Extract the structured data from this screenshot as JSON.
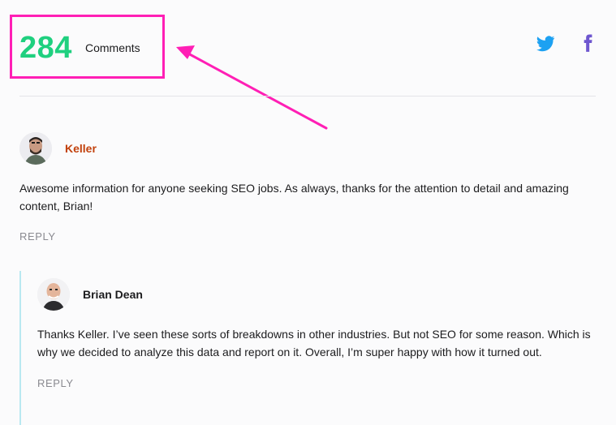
{
  "comments_header": {
    "count": "284",
    "label": "Comments"
  },
  "social": {
    "twitter": "twitter-icon",
    "facebook": "facebook-icon",
    "twitter_color": "#1da1f2",
    "facebook_color": "#6e56cf"
  },
  "annotation": {
    "highlight_color": "#ff1fb5"
  },
  "comments": [
    {
      "author": "Keller",
      "text": "Awesome information for anyone seeking SEO jobs. As always, thanks for the attention to detail and amazing content, Brian!",
      "reply_label": "REPLY"
    }
  ],
  "replies": [
    {
      "author": "Brian Dean",
      "text": "Thanks Keller. I’ve seen these sorts of breakdowns in other industries. But not SEO for some reason. Which is why we decided to analyze this data and report on it. Overall, I’m super happy with how it turned out.",
      "reply_label": "REPLY"
    }
  ],
  "colors": {
    "count_green": "#1fd07f",
    "author_orange": "#c2410c",
    "thread_line": "#b9e8f1"
  }
}
